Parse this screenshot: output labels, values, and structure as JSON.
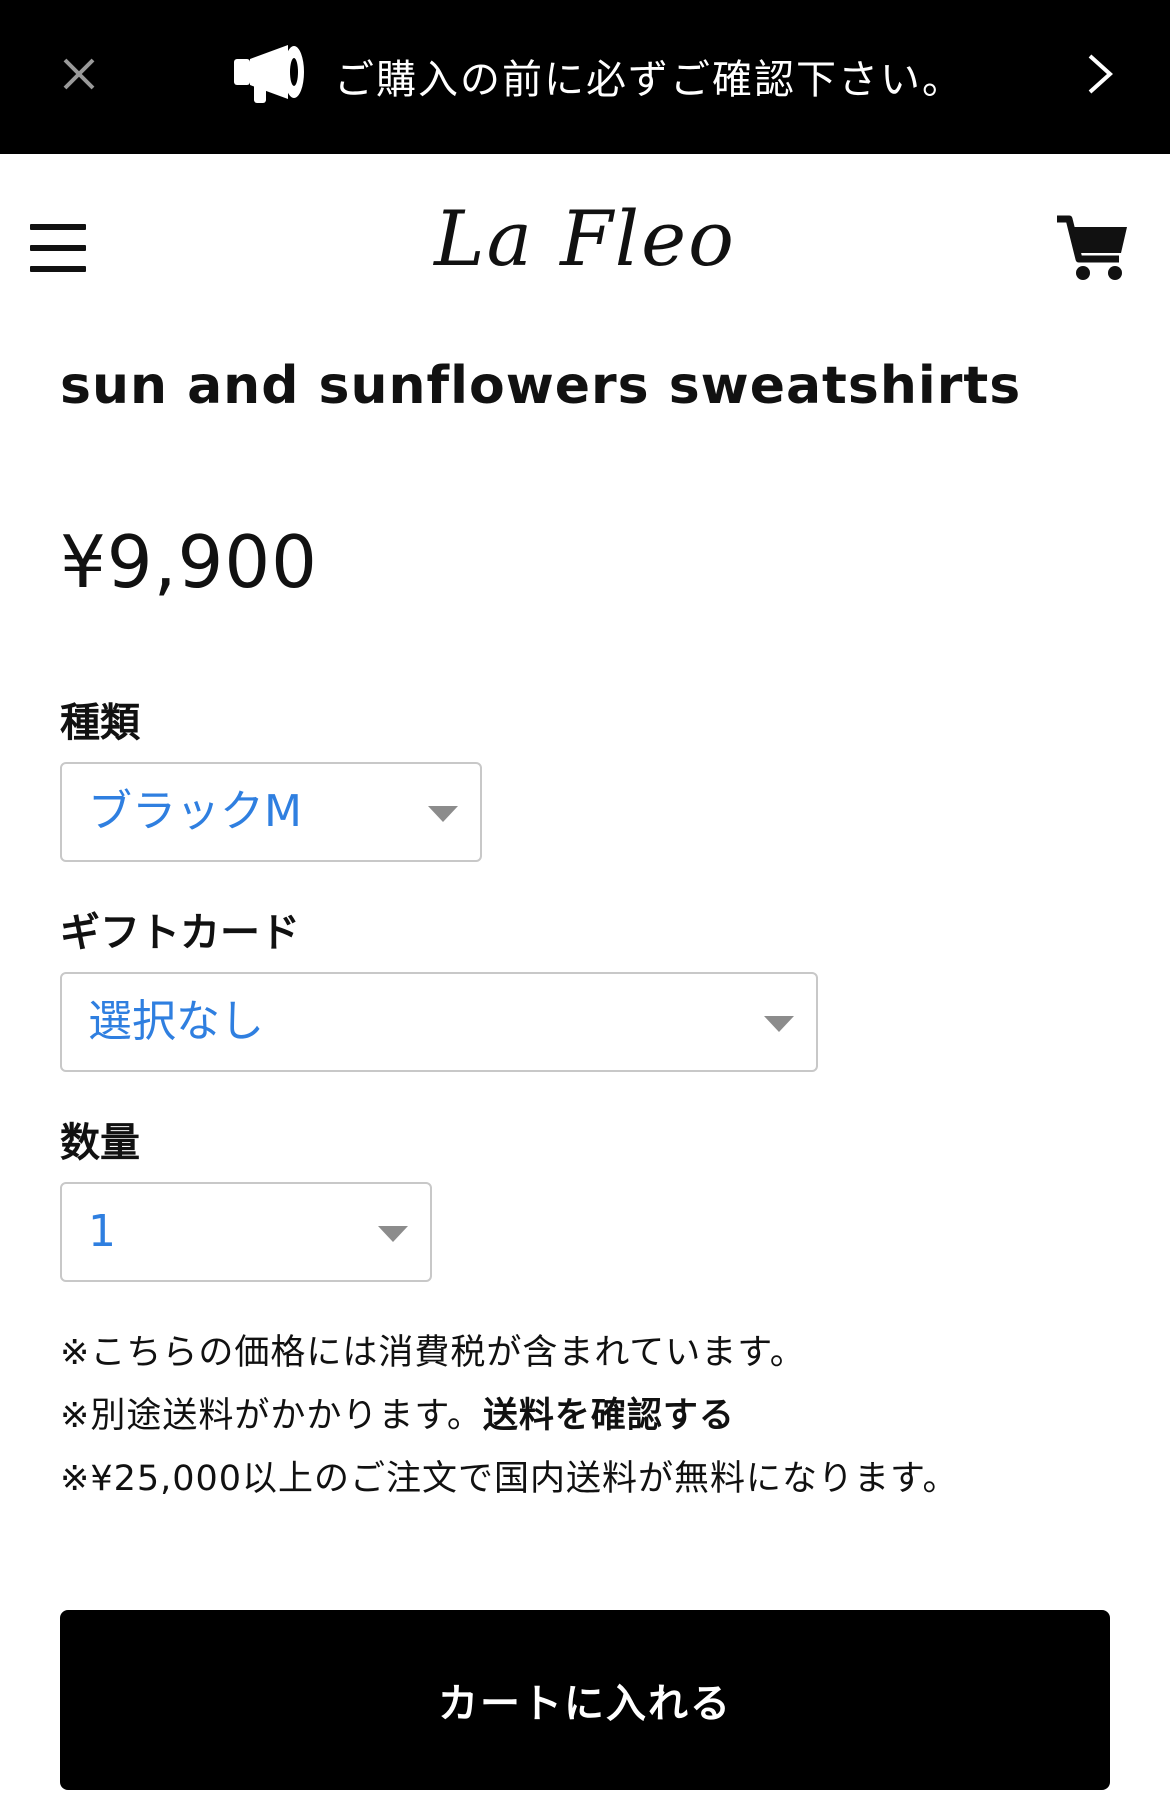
{
  "announcement": {
    "message": "ご購入の前に必ずご確認下さい。"
  },
  "header": {
    "logo": "La Fleo"
  },
  "product": {
    "title": "sun and sunflowers sweatshirts",
    "price": "¥9,900"
  },
  "options": {
    "type_label": "種類",
    "type_value": "ブラックM",
    "gift_label": "ギフトカード",
    "gift_value": "選択なし",
    "quantity_label": "数量",
    "quantity_value": "1"
  },
  "notes": {
    "tax": "※こちらの価格には消費税が含まれています。",
    "shipping_prefix": "※別途送料がかかります。",
    "shipping_link": "送料を確認する",
    "free_shipping": "※¥25,000以上のご注文で国内送料が無料になります。"
  },
  "actions": {
    "add_to_cart": "カートに入れる"
  }
}
